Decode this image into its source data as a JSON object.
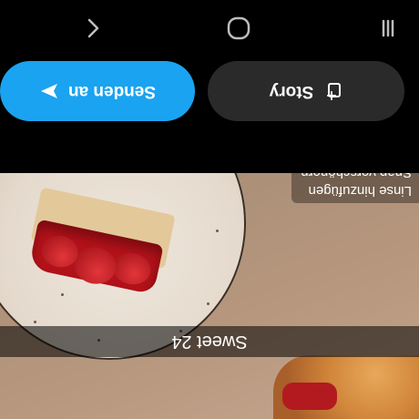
{
  "photo": {
    "caption": "Sweet 24"
  },
  "toast": {
    "line1": "Linse hinzufügen",
    "line2": "Snap verschönern"
  },
  "actions": {
    "story_label": "Story",
    "send_label": "Senden an"
  },
  "icons": {
    "story": "add-story-icon",
    "send": "send-arrow-icon",
    "nav_recent": "recent-apps-icon",
    "nav_home": "home-icon",
    "nav_back": "back-icon"
  },
  "colors": {
    "send_button": "#1aa3f0",
    "story_button": "#2a2a2a",
    "background": "#000000"
  }
}
